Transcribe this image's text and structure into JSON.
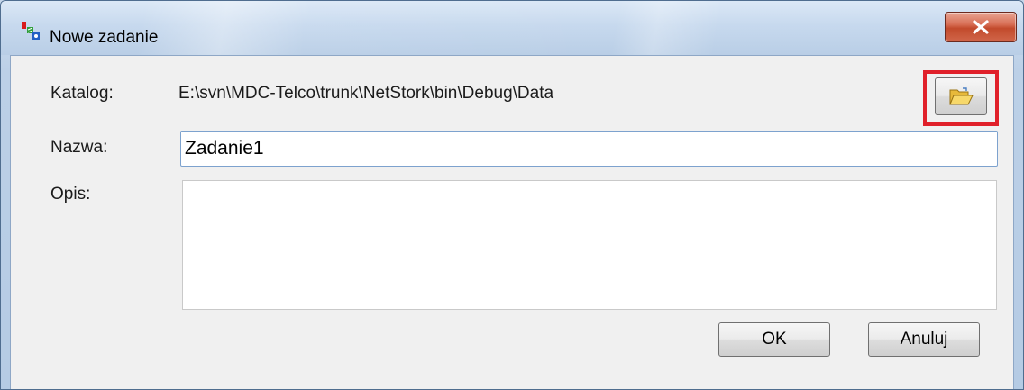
{
  "window": {
    "title": "Nowe zadanie"
  },
  "form": {
    "catalog_label": "Katalog:",
    "catalog_path": "E:\\svn\\MDC-Telco\\trunk\\NetStork\\bin\\Debug\\Data",
    "name_label": "Nazwa:",
    "name_value": "Zadanie1",
    "description_label": "Opis:",
    "description_value": ""
  },
  "buttons": {
    "ok_label": "OK",
    "cancel_label": "Anuluj"
  },
  "icons": {
    "app": "app-logo-icon",
    "close": "close-icon",
    "browse": "open-folder-icon"
  },
  "colors": {
    "highlight": "#e0202a",
    "close_button": "#c9553a",
    "folder": "#f2c94c"
  }
}
